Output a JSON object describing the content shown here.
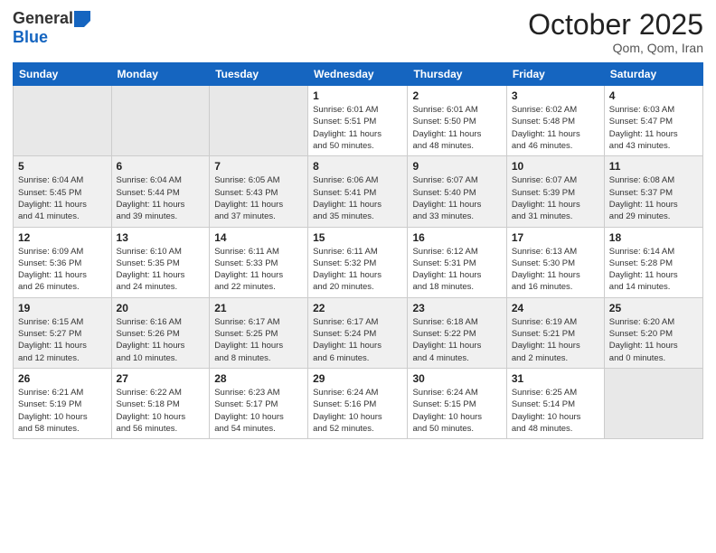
{
  "header": {
    "logo_general": "General",
    "logo_blue": "Blue",
    "month": "October 2025",
    "location": "Qom, Qom, Iran"
  },
  "days_of_week": [
    "Sunday",
    "Monday",
    "Tuesday",
    "Wednesday",
    "Thursday",
    "Friday",
    "Saturday"
  ],
  "weeks": [
    [
      {
        "day": "",
        "info": ""
      },
      {
        "day": "",
        "info": ""
      },
      {
        "day": "",
        "info": ""
      },
      {
        "day": "1",
        "info": "Sunrise: 6:01 AM\nSunset: 5:51 PM\nDaylight: 11 hours\nand 50 minutes."
      },
      {
        "day": "2",
        "info": "Sunrise: 6:01 AM\nSunset: 5:50 PM\nDaylight: 11 hours\nand 48 minutes."
      },
      {
        "day": "3",
        "info": "Sunrise: 6:02 AM\nSunset: 5:48 PM\nDaylight: 11 hours\nand 46 minutes."
      },
      {
        "day": "4",
        "info": "Sunrise: 6:03 AM\nSunset: 5:47 PM\nDaylight: 11 hours\nand 43 minutes."
      }
    ],
    [
      {
        "day": "5",
        "info": "Sunrise: 6:04 AM\nSunset: 5:45 PM\nDaylight: 11 hours\nand 41 minutes."
      },
      {
        "day": "6",
        "info": "Sunrise: 6:04 AM\nSunset: 5:44 PM\nDaylight: 11 hours\nand 39 minutes."
      },
      {
        "day": "7",
        "info": "Sunrise: 6:05 AM\nSunset: 5:43 PM\nDaylight: 11 hours\nand 37 minutes."
      },
      {
        "day": "8",
        "info": "Sunrise: 6:06 AM\nSunset: 5:41 PM\nDaylight: 11 hours\nand 35 minutes."
      },
      {
        "day": "9",
        "info": "Sunrise: 6:07 AM\nSunset: 5:40 PM\nDaylight: 11 hours\nand 33 minutes."
      },
      {
        "day": "10",
        "info": "Sunrise: 6:07 AM\nSunset: 5:39 PM\nDaylight: 11 hours\nand 31 minutes."
      },
      {
        "day": "11",
        "info": "Sunrise: 6:08 AM\nSunset: 5:37 PM\nDaylight: 11 hours\nand 29 minutes."
      }
    ],
    [
      {
        "day": "12",
        "info": "Sunrise: 6:09 AM\nSunset: 5:36 PM\nDaylight: 11 hours\nand 26 minutes."
      },
      {
        "day": "13",
        "info": "Sunrise: 6:10 AM\nSunset: 5:35 PM\nDaylight: 11 hours\nand 24 minutes."
      },
      {
        "day": "14",
        "info": "Sunrise: 6:11 AM\nSunset: 5:33 PM\nDaylight: 11 hours\nand 22 minutes."
      },
      {
        "day": "15",
        "info": "Sunrise: 6:11 AM\nSunset: 5:32 PM\nDaylight: 11 hours\nand 20 minutes."
      },
      {
        "day": "16",
        "info": "Sunrise: 6:12 AM\nSunset: 5:31 PM\nDaylight: 11 hours\nand 18 minutes."
      },
      {
        "day": "17",
        "info": "Sunrise: 6:13 AM\nSunset: 5:30 PM\nDaylight: 11 hours\nand 16 minutes."
      },
      {
        "day": "18",
        "info": "Sunrise: 6:14 AM\nSunset: 5:28 PM\nDaylight: 11 hours\nand 14 minutes."
      }
    ],
    [
      {
        "day": "19",
        "info": "Sunrise: 6:15 AM\nSunset: 5:27 PM\nDaylight: 11 hours\nand 12 minutes."
      },
      {
        "day": "20",
        "info": "Sunrise: 6:16 AM\nSunset: 5:26 PM\nDaylight: 11 hours\nand 10 minutes."
      },
      {
        "day": "21",
        "info": "Sunrise: 6:17 AM\nSunset: 5:25 PM\nDaylight: 11 hours\nand 8 minutes."
      },
      {
        "day": "22",
        "info": "Sunrise: 6:17 AM\nSunset: 5:24 PM\nDaylight: 11 hours\nand 6 minutes."
      },
      {
        "day": "23",
        "info": "Sunrise: 6:18 AM\nSunset: 5:22 PM\nDaylight: 11 hours\nand 4 minutes."
      },
      {
        "day": "24",
        "info": "Sunrise: 6:19 AM\nSunset: 5:21 PM\nDaylight: 11 hours\nand 2 minutes."
      },
      {
        "day": "25",
        "info": "Sunrise: 6:20 AM\nSunset: 5:20 PM\nDaylight: 11 hours\nand 0 minutes."
      }
    ],
    [
      {
        "day": "26",
        "info": "Sunrise: 6:21 AM\nSunset: 5:19 PM\nDaylight: 10 hours\nand 58 minutes."
      },
      {
        "day": "27",
        "info": "Sunrise: 6:22 AM\nSunset: 5:18 PM\nDaylight: 10 hours\nand 56 minutes."
      },
      {
        "day": "28",
        "info": "Sunrise: 6:23 AM\nSunset: 5:17 PM\nDaylight: 10 hours\nand 54 minutes."
      },
      {
        "day": "29",
        "info": "Sunrise: 6:24 AM\nSunset: 5:16 PM\nDaylight: 10 hours\nand 52 minutes."
      },
      {
        "day": "30",
        "info": "Sunrise: 6:24 AM\nSunset: 5:15 PM\nDaylight: 10 hours\nand 50 minutes."
      },
      {
        "day": "31",
        "info": "Sunrise: 6:25 AM\nSunset: 5:14 PM\nDaylight: 10 hours\nand 48 minutes."
      },
      {
        "day": "",
        "info": ""
      }
    ]
  ]
}
